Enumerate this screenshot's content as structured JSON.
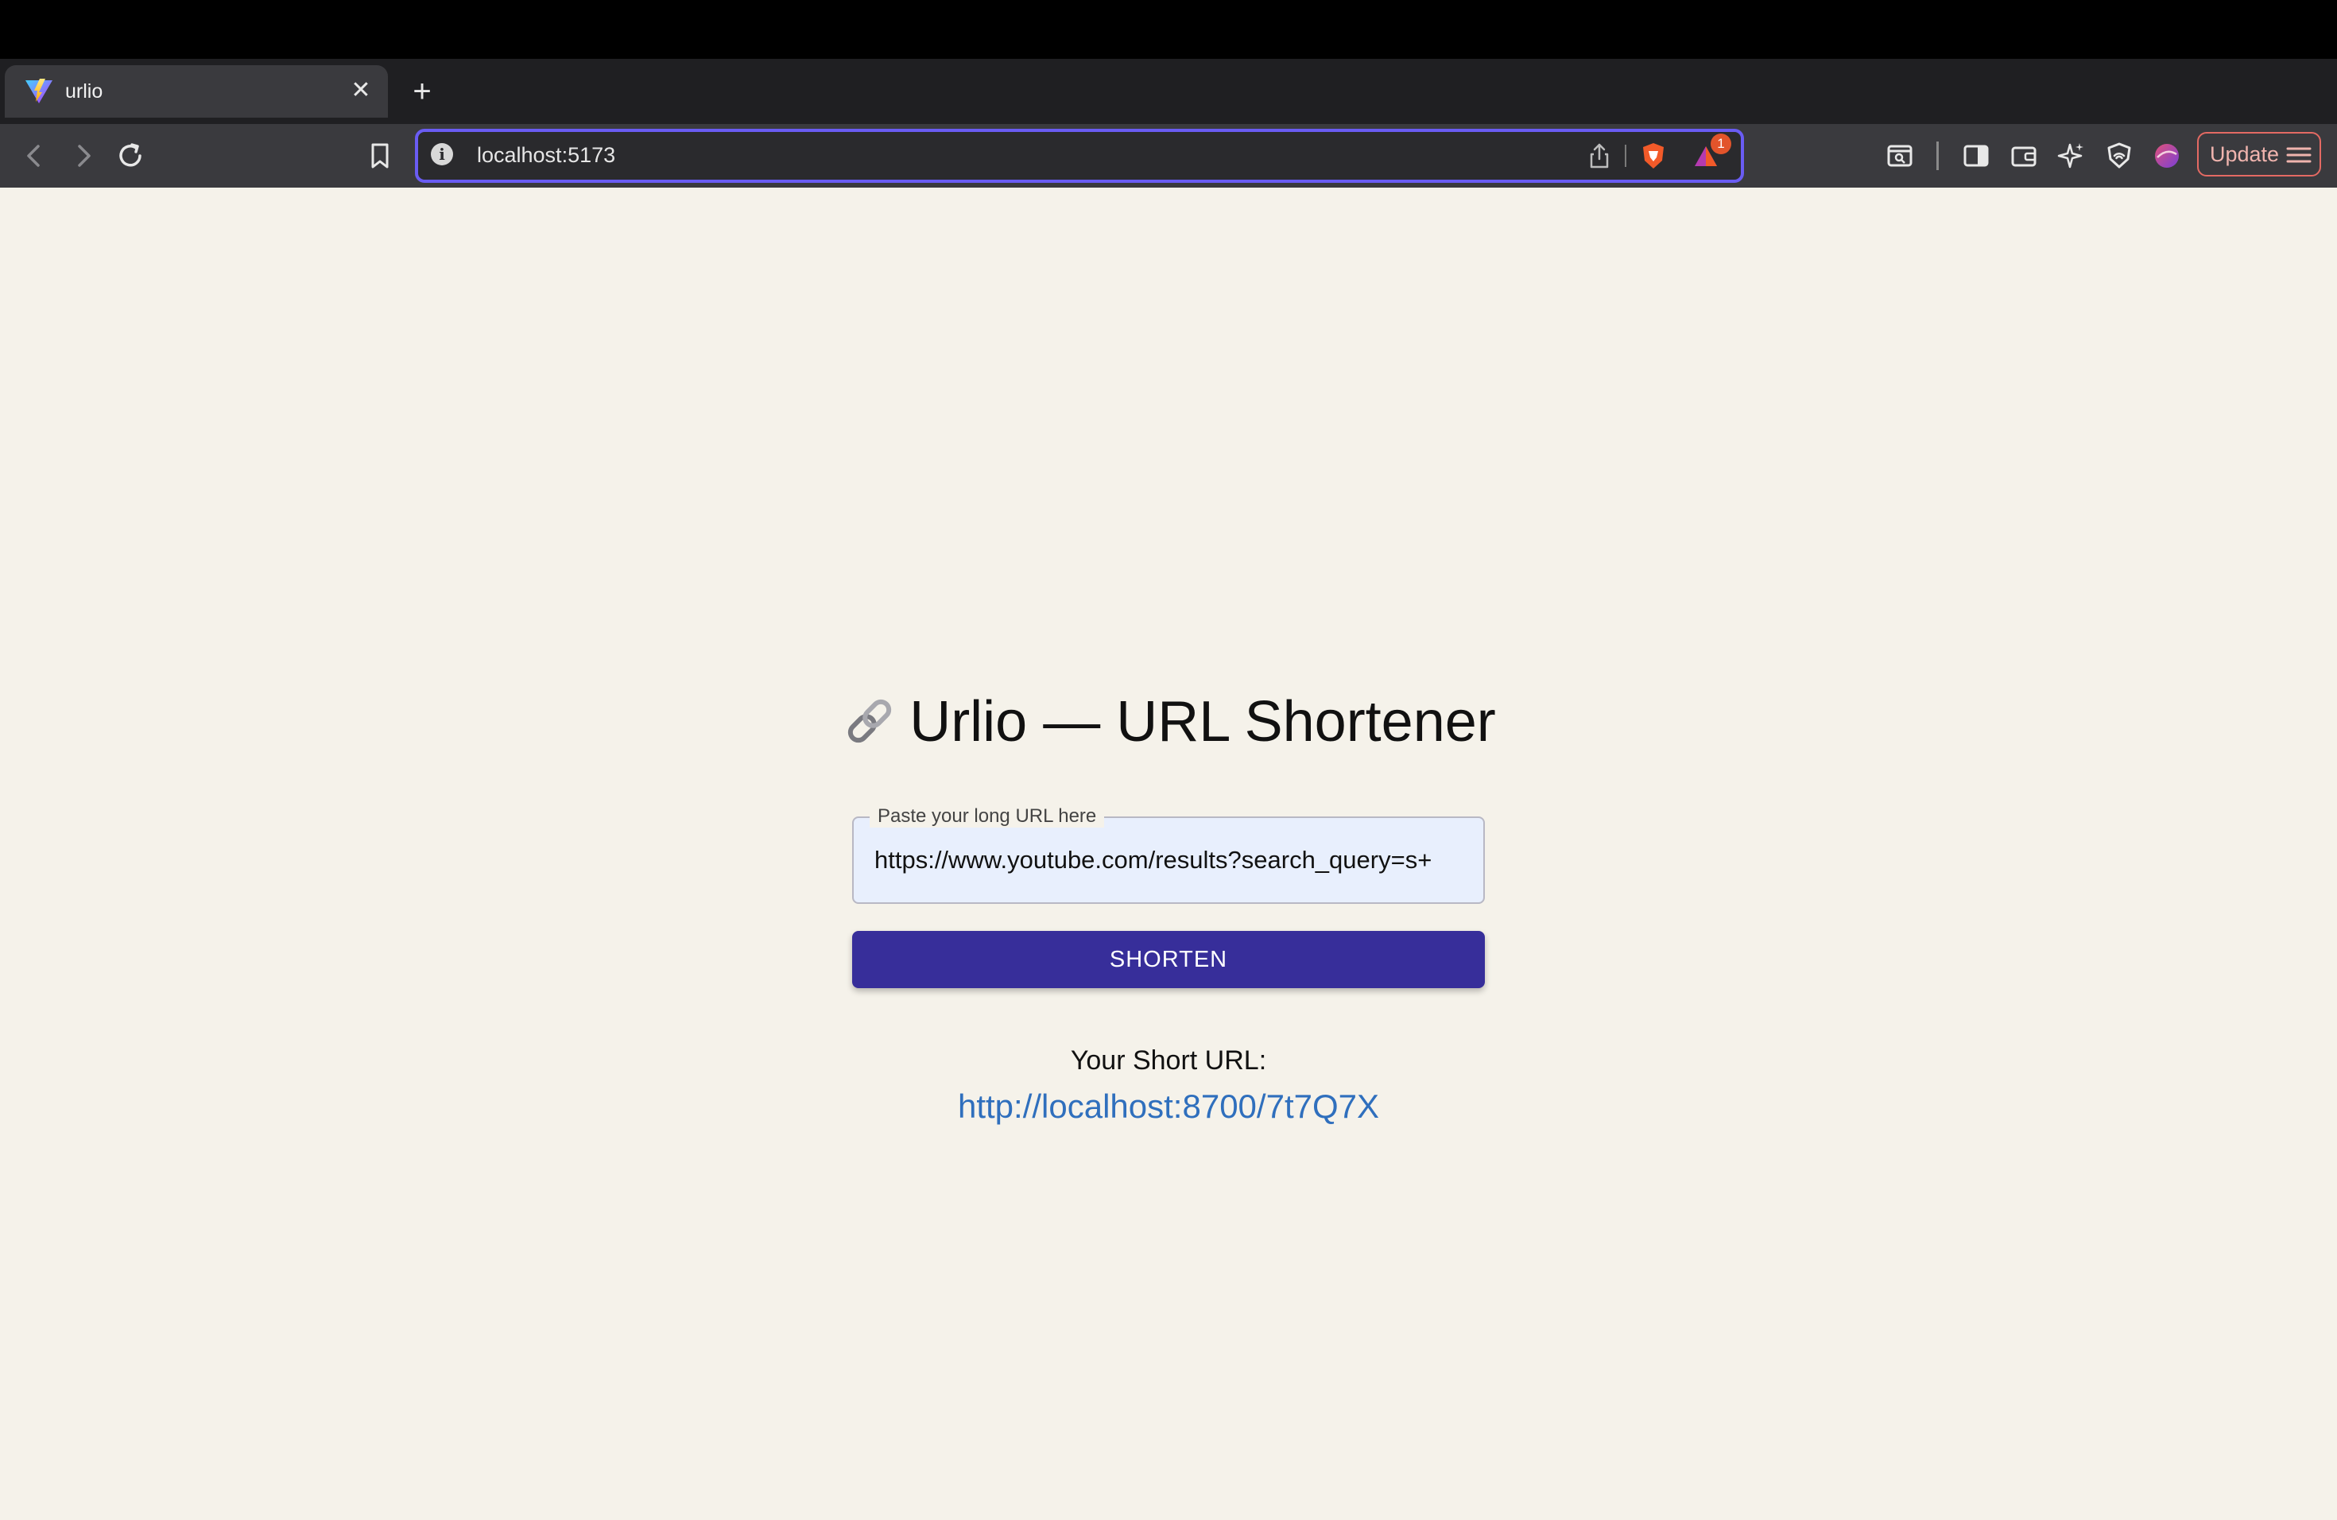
{
  "browser": {
    "tab": {
      "title": "urlio",
      "close_glyph": "✕",
      "favicon": "vite-logo-icon"
    },
    "new_tab_glyph": "+",
    "address_bar": {
      "url": "localhost:5173",
      "info_glyph": "i"
    },
    "shields_badge_count": "1",
    "update_label": "Update",
    "icons": {
      "back": "back-arrow-icon",
      "forward": "forward-arrow-icon",
      "reload": "reload-icon",
      "bookmark": "bookmark-icon",
      "share": "share-icon",
      "brave_shields": "brave-shields-icon",
      "brave_rewards": "brave-rewards-icon",
      "screenshot": "page-search-icon",
      "sidebar": "sidebar-icon",
      "wallet": "wallet-icon",
      "leo": "leo-ai-icon",
      "vpn": "vpn-icon",
      "profile": "profile-icon",
      "menu": "hamburger-menu-icon"
    },
    "accent_color": "#6a5cf3"
  },
  "app": {
    "title_emoji_name": "link-icon",
    "title": "Urlio — URL Shortener",
    "input": {
      "label": "Paste your long URL here",
      "value": "https://www.youtube.com/results?search_query=s+"
    },
    "shorten_button_label": "SHORTEN",
    "result_label": "Your Short URL:",
    "short_url": "http://localhost:8700/7t7Q7X",
    "colors": {
      "background": "#f5f2ea",
      "button": "#372e9a",
      "link": "#2f6fbd",
      "input_bg": "#e8effd"
    }
  }
}
